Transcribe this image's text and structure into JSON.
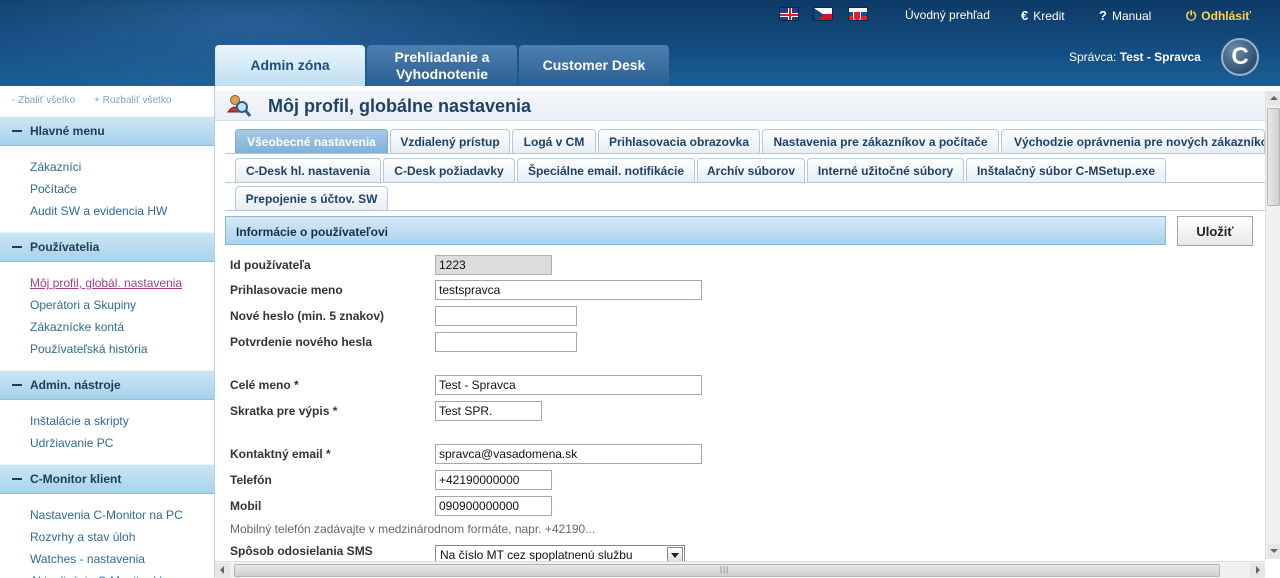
{
  "header": {
    "links": {
      "overview": "Úvodný prehľad",
      "credit": "Kredit",
      "manual": "Manual",
      "logout": "Odhlásiť"
    },
    "tabs": {
      "admin": "Admin zóna",
      "review_line1": "Prehliadanie a",
      "review_line2": "Vyhodnotenie",
      "desk": "Customer Desk"
    },
    "admin_prefix": "Správca:",
    "admin_name": "Test - Spravca"
  },
  "sidebar": {
    "collapse_all": "- Zbaliť všetko",
    "expand_all": "+ Rozbaliť všetko",
    "sections": [
      {
        "title": "Hlavné menu",
        "items": [
          "Zákazníci",
          "Počítače",
          "Audit SW a evidencia HW"
        ]
      },
      {
        "title": "Používatelia",
        "items": [
          "Môj profil, globál. nastavenia",
          "Operátori a Skupiny",
          "Zákaznícke kontá",
          "Používateľská história"
        ]
      },
      {
        "title": "Admin. nástroje",
        "items": [
          "Inštalácie a skripty",
          "Udržiavanie PC"
        ]
      },
      {
        "title": "C-Monitor klient",
        "items": [
          "Nastavenia C-Monitor na PC",
          "Rozvrhy a stav úloh",
          "Watches - nastavenia",
          "Aktualizácia C-Monitor kl."
        ]
      }
    ]
  },
  "main": {
    "page_title": "Môj profil, globálne nastavenia",
    "tabs_row1": [
      "Všeobecné nastavenia",
      "Vzdialený prístup",
      "Logá v CM",
      "Prihlasovacia obrazovka",
      "Nastavenia pre zákazníkov a počítače",
      "Východzie oprávnenia pre nových zákazníkov"
    ],
    "tabs_row2": [
      "C-Desk hl. nastavenia",
      "C-Desk požiadavky",
      "Špeciálne email. notifikácie",
      "Archív súborov",
      "Interné užitočné súbory",
      "Inštalačný súbor C-MSetup.exe"
    ],
    "tabs_row3": [
      "Prepojenie s účtov. SW"
    ],
    "section_title": "Informácie o používateľovi",
    "save_label": "Uložiť",
    "fields": {
      "user_id": {
        "label": "Id používateľa",
        "value": "1223"
      },
      "login": {
        "label": "Prihlasovacie meno",
        "value": "testspravca"
      },
      "new_password": {
        "label": "Nové heslo (min. 5 znakov)",
        "value": ""
      },
      "confirm_password": {
        "label": "Potvrdenie nového hesla",
        "value": ""
      },
      "full_name": {
        "label": "Celé meno *",
        "value": "Test - Spravca"
      },
      "short_name": {
        "label": "Skratka pre výpis *",
        "value": "Test SPR."
      },
      "email": {
        "label": "Kontaktný email *",
        "value": "spravca@vasadomena.sk"
      },
      "phone": {
        "label": "Telefón",
        "value": "+42190000000"
      },
      "mobile": {
        "label": "Mobil",
        "value": "090900000000"
      }
    },
    "mobile_note": "Mobilný telefón zadávajte v medzinárodnom formáte, napr. +42190...",
    "sms_label": "Spôsob odosielania SMS",
    "sms_value": "Na číslo MT cez spoplatnenú službu"
  }
}
